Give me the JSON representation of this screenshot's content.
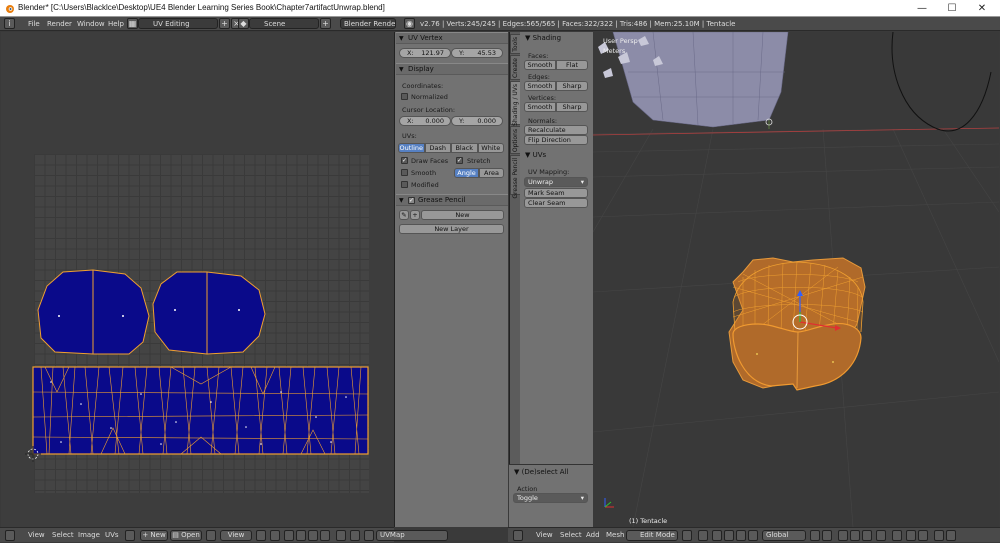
{
  "window": {
    "title": "Blender* [C:\\Users\\Blacklce\\Desktop\\UE4 Blender Learning Series Book\\Chapter7artifactUnwrap.blend]",
    "minimize_glyph": "—",
    "maximize_glyph": "☐",
    "close_glyph": "✕"
  },
  "topbar": {
    "menu": [
      "File",
      "Render",
      "Window",
      "Help"
    ],
    "screen_layout": "UV Editing",
    "scene": "Scene",
    "render_engine": "Blender Render",
    "stats": "v2.76 | Verts:245/245 | Edges:565/565 | Faces:322/322 | Tris:486 | Mem:25.10M | Tentacle"
  },
  "uv_vertex_panel": {
    "title": "UV Vertex",
    "x_label": "X:",
    "x_value": "121.97",
    "y_label": "Y:",
    "y_value": "45.53"
  },
  "display_panel": {
    "title": "Display",
    "coordinates_label": "Coordinates:",
    "normalized_label": "Normalized",
    "cursor_location_label": "Cursor Location:",
    "cursor_x_label": "X:",
    "cursor_x": "0.000",
    "cursor_y_label": "Y:",
    "cursor_y": "0.000",
    "uvs_label": "UVs:",
    "uv_modes": [
      "Outline",
      "Dash",
      "Black",
      "White"
    ],
    "uv_mode_active": "Outline",
    "draw_faces_label": "Draw Faces",
    "stretch_label": "Stretch",
    "smooth_label": "Smooth",
    "stretch_modes": [
      "Angle",
      "Area"
    ],
    "stretch_mode_active": "Angle",
    "modified_label": "Modified"
  },
  "grease_pencil_panel": {
    "title": "Grease Pencil",
    "new_label": "New",
    "new_layer_label": "New Layer"
  },
  "tool_tabs": [
    "Tools",
    "Create",
    "Shading / UVs",
    "Options",
    "Grease Pencil"
  ],
  "shading_panel": {
    "title": "Shading",
    "faces_label": "Faces:",
    "edges_label": "Edges:",
    "vertices_label": "Vertices:",
    "smooth_label": "Smooth",
    "flat_label": "Flat",
    "sharp_label": "Sharp",
    "normals_label": "Normals:",
    "recalculate_label": "Recalculate",
    "flip_direction_label": "Flip Direction"
  },
  "uvs_panel": {
    "title": "UVs",
    "uv_mapping_label": "UV Mapping:",
    "unwrap_label": "Unwrap",
    "mark_seam_label": "Mark Seam",
    "clear_seam_label": "Clear Seam"
  },
  "operator_panel": {
    "title": "(De)select All",
    "action_label": "Action",
    "action_value": "Toggle"
  },
  "viewport": {
    "view_name": "User Persp",
    "units": "Meters",
    "object_label": "(1) Tentacle"
  },
  "uv_bottombar": {
    "menus": [
      "View",
      "Select",
      "Image",
      "UVs"
    ],
    "new_label": "New",
    "open_label": "Open",
    "view_label": "View",
    "uvmap_label": "UVMap"
  },
  "view3d_bottombar": {
    "menus": [
      "View",
      "Select",
      "Add",
      "Mesh"
    ],
    "mode_label": "Edit Mode",
    "orientation_label": "Global"
  },
  "colors": {
    "uv_face_fill": "#0a0a8a",
    "uv_edge": "#f0a030",
    "selected_mesh": "#e89a3a",
    "active_button": "#5680c2",
    "panel_bg": "#727272",
    "viewport_bg": "#393939"
  }
}
